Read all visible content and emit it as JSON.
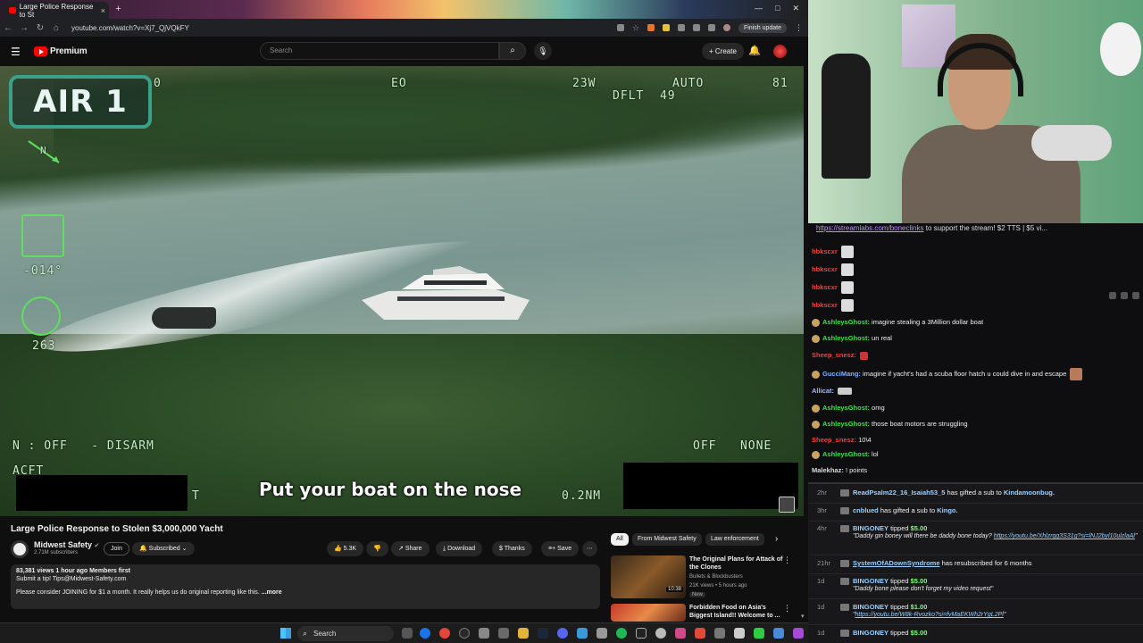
{
  "browser": {
    "tab_title": "Large Police Response to St",
    "url": "youtube.com/watch?v=Xj7_QjVQkFY",
    "finish_update": "Finish update"
  },
  "youtube": {
    "logo_text": "Premium",
    "search_placeholder": "Search",
    "create_label": "Create"
  },
  "video": {
    "badge": "AIR 1",
    "hud": {
      "tl": "0",
      "eo": "EO",
      "heading": "23W",
      "auto": "AUTO",
      "dflt": "DFLT  49",
      "num81": "81",
      "compass": "N",
      "tilt": "-014°",
      "azimuth": "263",
      "status_left": "N : OFF   - DISARM",
      "acft": "ACFT",
      "status_right": "OFF   NONE",
      "range": "0.2NM",
      "t": "T"
    },
    "caption": "Put your boat on the nose"
  },
  "info": {
    "title": "Large Police Response to Stolen $3,000,000 Yacht",
    "channel": "Midwest Safety",
    "subscribers": "2.71M subscribers",
    "join": "Join",
    "subscribed": "Subscribed",
    "likes": "5.3K",
    "share": "Share",
    "download": "Download",
    "thanks": "Thanks",
    "save": "Save",
    "meta": "83,381 views  1 hour ago  Members first",
    "line1": "Submit a tip! Tips@Midwest-Safety.com",
    "line2": "Please consider JOINING for $1 a month. It really helps us do original reporting like this.",
    "more": "...more"
  },
  "recs": {
    "chips": [
      "All",
      "From Midwest Safety",
      "Law enforcement"
    ],
    "items": [
      {
        "title": "The Original Plans for Attack of the Clones",
        "channel": "Bullets & Blockbusters",
        "meta": "21K views • 5 hours ago",
        "badge": "New",
        "duration": "10:38"
      },
      {
        "title": "Forbidden Food on Asia's Biggest Island!! Welcome to ..."
      }
    ]
  },
  "taskbar": {
    "search": "Search"
  },
  "chat": {
    "banner_link": "https://streamlabs.com/boneclinks",
    "banner_rest": " to support the stream! $2 TTS | $5 vi...",
    "lines": [
      {
        "user": "hbkscxr",
        "msg": ""
      },
      {
        "user": "hbkscxr",
        "msg": ""
      },
      {
        "user": "hbkscxr",
        "msg": ""
      },
      {
        "user": "hbkscxr",
        "msg": ""
      },
      {
        "user": "AshleysGhost:",
        "msg": " imagine stealing a 3Million dollar boat"
      },
      {
        "user": "AshleysGhost:",
        "msg": " un real"
      },
      {
        "user": "Sheep_snesz:",
        "msg": ""
      },
      {
        "user": "GucciMang:",
        "msg": " imagine if yacht's had a scuba floor hatch u could dive in and escape"
      },
      {
        "user": "Allicat:",
        "msg": ""
      },
      {
        "user": "AshleysGhost:",
        "msg": " omg"
      },
      {
        "user": "AshleysGhost:",
        "msg": " those boat motors are struggling"
      },
      {
        "user": "Sheep_snesz:",
        "msg": " 10\\4"
      },
      {
        "user": "AshleysGhost:",
        "msg": " lol"
      },
      {
        "user": "Malekhaz:",
        "msg": " ! points"
      }
    ]
  },
  "feed": [
    {
      "time": "2hr",
      "user": "ReadPsalm22_16_Isaiah53_5",
      "text": " has gifted a sub to ",
      "target": "Kindamoonbug."
    },
    {
      "time": "3hr",
      "user": "cnblued",
      "text": " has gifted a sub to ",
      "target": "Kingo."
    },
    {
      "time": "4hr",
      "user": "BINGONEY",
      "text": " tipped ",
      "amount": "$5.00",
      "quote": "\"Daddy gin boney will there be daddy bone today? ",
      "link": "https://youtu.be/Xhlzrgg3S31g?si=lNJ2byl10ulzlaAl",
      "quote_end": "\""
    },
    {
      "time": "21hr",
      "user": "SystemOfADownSyndrome",
      "text": " has resubscribed for 6 months"
    },
    {
      "time": "1d",
      "user": "BINGONEY",
      "text": " tipped ",
      "amount": "$5.00",
      "quote": "\"Daddy bone please don't forget my video request\""
    },
    {
      "time": "1d",
      "user": "BINGONEY",
      "text": " tipped ",
      "amount": "$1.00",
      "quote": "\"",
      "link": "https://youtu.be/W8k-Rvozko?si=fvMaEKWh2rYgL2Pl",
      "quote_end": "\""
    },
    {
      "time": "1d",
      "user": "BINGONEY",
      "text": " tipped ",
      "amount": "$5.00"
    }
  ]
}
